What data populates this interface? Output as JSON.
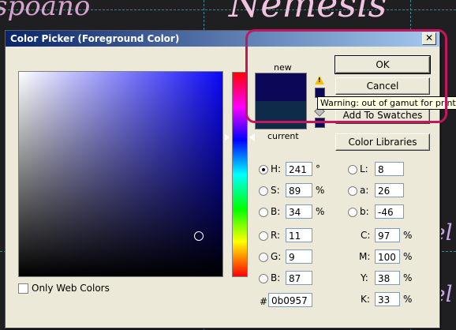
{
  "background": {
    "texts": [
      "spoano",
      "Nemesis",
      "el",
      "el",
      "",
      "",
      ""
    ]
  },
  "dialog": {
    "title": "Color Picker (Foreground Color)",
    "close_label": "✕",
    "new_label": "new",
    "current_label": "current",
    "tooltip": "Warning: out of gamut for printing",
    "buttons": {
      "ok": "OK",
      "cancel": "Cancel",
      "add_swatches": "Add To Swatches",
      "color_libraries": "Color Libraries"
    },
    "only_web_colors": "Only Web Colors",
    "hsb": {
      "h": {
        "label": "H:",
        "value": "241",
        "unit": "°"
      },
      "s": {
        "label": "S:",
        "value": "89",
        "unit": "%"
      },
      "b": {
        "label": "B:",
        "value": "34",
        "unit": "%"
      }
    },
    "lab": {
      "l": {
        "label": "L:",
        "value": "8"
      },
      "a": {
        "label": "a:",
        "value": "26"
      },
      "b": {
        "label": "b:",
        "value": "-46"
      }
    },
    "rgb": {
      "r": {
        "label": "R:",
        "value": "11"
      },
      "g": {
        "label": "G:",
        "value": "9"
      },
      "b": {
        "label": "B:",
        "value": "87"
      }
    },
    "cmyk": {
      "c": {
        "label": "C:",
        "value": "97",
        "unit": "%"
      },
      "m": {
        "label": "M:",
        "value": "100",
        "unit": "%"
      },
      "y": {
        "label": "Y:",
        "value": "38",
        "unit": "%"
      },
      "k": {
        "label": "K:",
        "value": "33",
        "unit": "%"
      }
    },
    "hex": {
      "label": "#",
      "value": "0b0957"
    }
  },
  "colors": {
    "new_color": "#0b0957",
    "current_color": "#0e2c4a",
    "highlight": "#c2185b"
  },
  "icons": [
    "close-icon",
    "warning-icon",
    "cube-icon"
  ]
}
